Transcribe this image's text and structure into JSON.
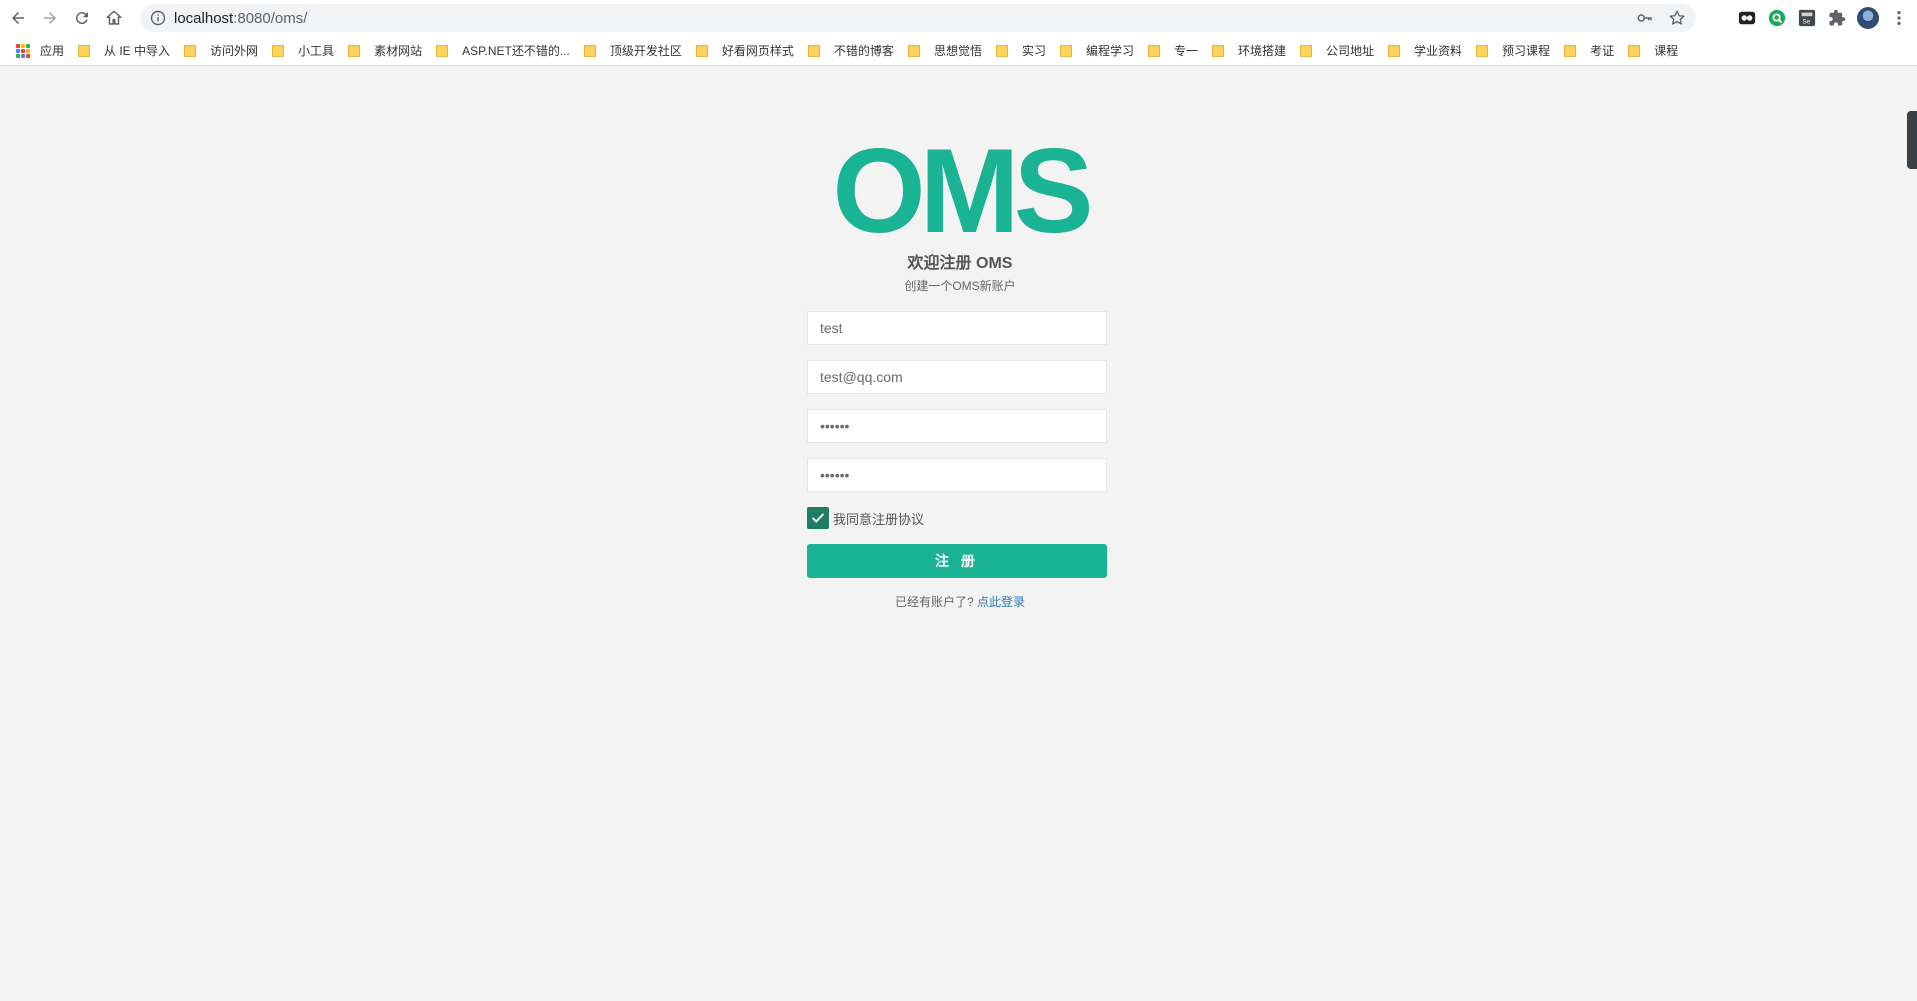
{
  "browser": {
    "url_host": "localhost",
    "url_path": ":8080/oms/",
    "nav_icons": [
      "back-icon",
      "forward-icon",
      "reload-icon",
      "home-icon"
    ],
    "omnibox_icons": [
      "site-info-icon",
      "key-icon",
      "bookmark-star-icon"
    ],
    "extension_icons": [
      "extension-icon-1",
      "extension-icon-2",
      "extension-icon-3",
      "puzzle-icon",
      "menu-dots-icon"
    ]
  },
  "bookmarks": {
    "apps_label": "应用",
    "items": [
      "从 IE 中导入",
      "访问外网",
      "小工具",
      "素材网站",
      "ASP.NET还不错的...",
      "顶级开发社区",
      "好看网页样式",
      "不错的博客",
      "思想觉悟",
      "实习",
      "编程学习",
      "专一",
      "环境搭建",
      "公司地址",
      "学业资料",
      "预习课程",
      "考证",
      "课程"
    ]
  },
  "register": {
    "logo": "OMS",
    "title": "欢迎注册 OMS",
    "subtitle": "创建一个OMS新账户",
    "username": "test",
    "email": "test@qq.com",
    "password": "••••••",
    "confirm_password": "••••••",
    "agree_label": "我同意注册协议",
    "agree_checked": true,
    "submit_label": "注 册",
    "login_prompt": "已经有账户了?",
    "login_link": "点此登录"
  },
  "colors": {
    "brand": "#1ab394",
    "checkbox": "#1e7e63",
    "link": "#337ab7",
    "background": "#f3f3f3"
  }
}
